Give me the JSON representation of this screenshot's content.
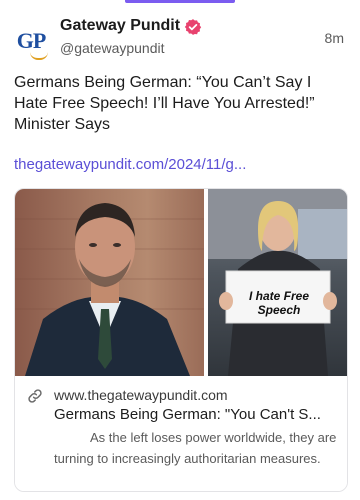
{
  "post": {
    "author": "Gateway Pundit",
    "handle": "@gatewaypundit",
    "timestamp": "8m",
    "avatar_text": "GP",
    "text": "Germans Being German: “You Can’t Say I Hate Free Speech! I’ll Have You Arrested!” Minister Says",
    "link_text": "thegatewaypundit.com/2024/11/g..."
  },
  "link_card": {
    "domain": "www.thegatewaypundit.com",
    "title": "Germans Being German: \"You Can't S...",
    "description": "As the left loses power worldwide, they are turning to increasingly authoritarian measures.",
    "sign_text": "I hate Free Speech"
  },
  "colors": {
    "accent": "#7b5cf0",
    "link": "#5b4fd6",
    "verified": "#e8426e",
    "avatar_blue": "#1f4fa0"
  },
  "icons": {
    "verified": "verified-badge-icon",
    "link": "link-icon"
  }
}
